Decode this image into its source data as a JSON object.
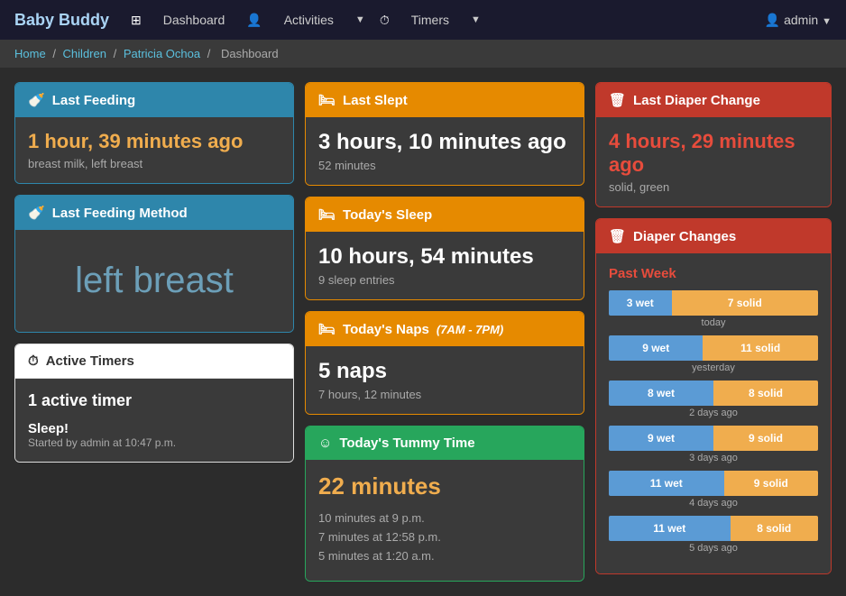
{
  "brand": {
    "name": "Baby Buddy",
    "baby": "Baby",
    "buddy": " Buddy"
  },
  "nav": {
    "dashboard": "Dashboard",
    "activities": "Activities",
    "timers": "Timers",
    "admin": "admin"
  },
  "breadcrumb": {
    "home": "Home",
    "children": "Children",
    "child": "Patricia Ochoa",
    "current": "Dashboard"
  },
  "last_feeding": {
    "title": "Last Feeding",
    "time": "1 hour, 39 minutes ago",
    "detail": "breast milk, left breast"
  },
  "last_feeding_method": {
    "title": "Last Feeding Method",
    "method": "left breast"
  },
  "active_timers": {
    "title": "Active Timers",
    "count": "1 active timer",
    "name": "Sleep!",
    "started": "Started by admin at 10:47 p.m."
  },
  "last_slept": {
    "title": "Last Slept",
    "time": "3 hours, 10 minutes ago",
    "detail": "52 minutes"
  },
  "todays_sleep": {
    "title": "Today's Sleep",
    "time": "10 hours, 54 minutes",
    "detail": "9 sleep entries"
  },
  "todays_naps": {
    "title": "Today's Naps",
    "range": "(7AM - 7PM)",
    "count": "5 naps",
    "detail": "7 hours, 12 minutes"
  },
  "last_diaper": {
    "title": "Last Diaper Change",
    "time": "4 hours, 29 minutes ago",
    "detail": "solid, green"
  },
  "diaper_changes": {
    "title": "Diaper Changes",
    "past_week": "Past Week",
    "rows": [
      {
        "wet": 3,
        "solid": 7,
        "label": "today",
        "wet_pct": 30,
        "solid_pct": 70
      },
      {
        "wet": 9,
        "solid": 11,
        "label": "yesterday",
        "wet_pct": 45,
        "solid_pct": 55
      },
      {
        "wet": 8,
        "solid": 8,
        "label": "2 days ago",
        "wet_pct": 50,
        "solid_pct": 50
      },
      {
        "wet": 9,
        "solid": 9,
        "label": "3 days ago",
        "wet_pct": 50,
        "solid_pct": 50
      },
      {
        "wet": 11,
        "solid": 9,
        "label": "4 days ago",
        "wet_pct": 55,
        "solid_pct": 45
      },
      {
        "wet": 11,
        "solid": 8,
        "label": "5 days ago",
        "wet_pct": 58,
        "solid_pct": 42
      }
    ]
  },
  "tummy_time": {
    "title": "Today's Tummy Time",
    "minutes": "22 minutes",
    "entries": [
      "10 minutes at 9 p.m.",
      "7 minutes at 12:58 p.m.",
      "5 minutes at 1:20 a.m."
    ]
  }
}
